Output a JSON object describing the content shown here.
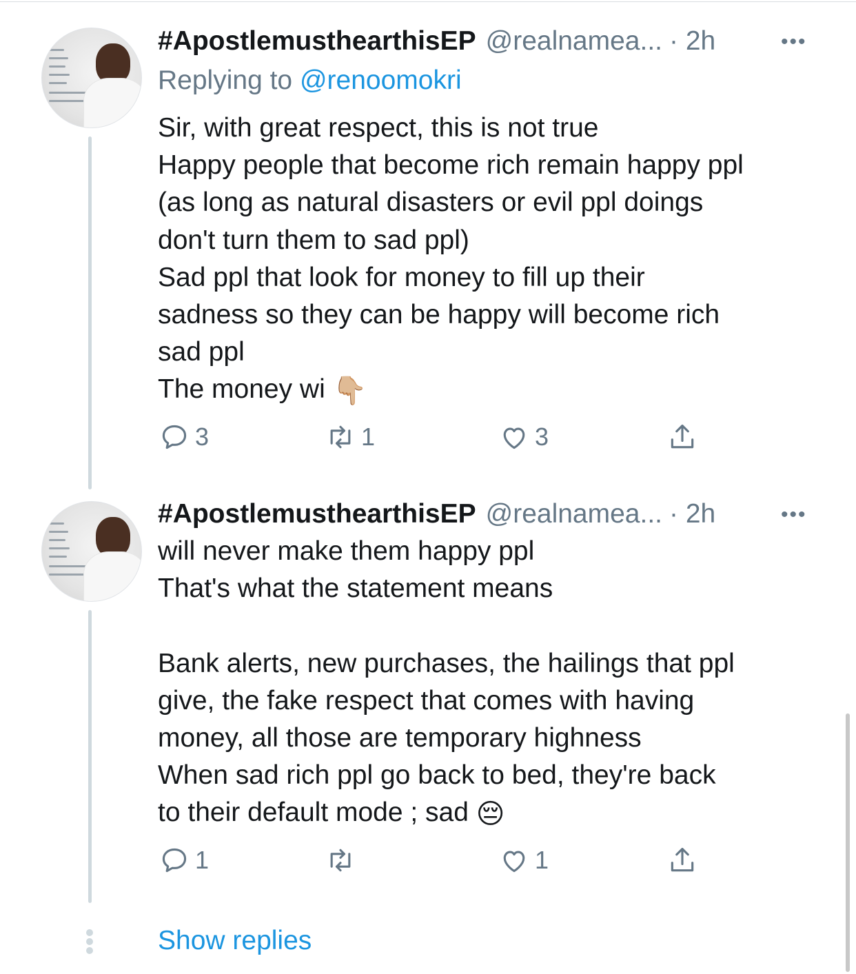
{
  "tweets": [
    {
      "name": "#ApostlemusthearthisEP",
      "handle": "@realnamea...",
      "time": "· 2h",
      "more_label": "•••",
      "replying_prefix": "Replying to ",
      "replying_handle": "@renoomokri",
      "text": "Sir, with great respect, this is not true\nHappy people that become rich remain happy ppl\n(as long as natural disasters or evil ppl doings\ndon't turn them to sad ppl)\nSad ppl that look for money to fill up their\nsadness so they can be happy will become rich\nsad ppl\nThe money wi ",
      "emoji": "👇🏼",
      "replies": "3",
      "retweets": "1",
      "likes": "3"
    },
    {
      "name": "#ApostlemusthearthisEP",
      "handle": "@realnamea...",
      "time": "· 2h",
      "more_label": "•••",
      "text": "will never make them happy ppl\nThat's what the statement means\n\nBank alerts, new purchases, the hailings that ppl\ngive, the fake respect that comes with having\nmoney, all those are temporary highness\nWhen sad rich ppl go back to bed, they're back\nto their default mode ; sad ",
      "emoji": "😔",
      "replies": "1",
      "retweets": "",
      "likes": "1"
    }
  ],
  "show_replies": "Show replies",
  "icons": [
    "reply-icon",
    "retweet-icon",
    "like-icon",
    "share-icon",
    "more-icon",
    "thread-dots-icon"
  ],
  "colors": {
    "link": "#1b95e0",
    "muted": "#657786",
    "text": "#14171a",
    "thread_line": "#cfd9de"
  }
}
